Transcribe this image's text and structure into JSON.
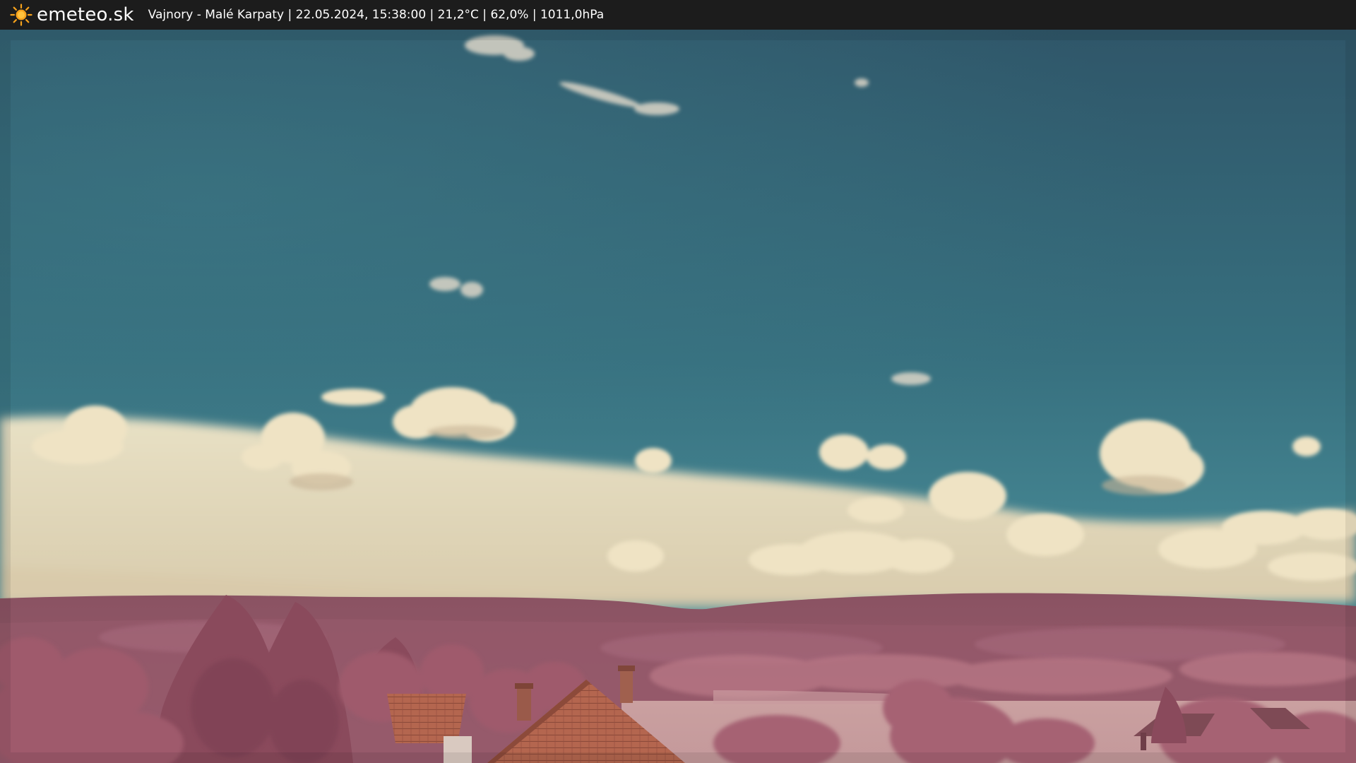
{
  "header": {
    "logo_icon": "sun-icon",
    "site_name": "emeteo.sk",
    "caption": "Vajnory - Malé Karpaty | 22.05.2024, 15:38:00 | 21,2°C | 62,0% | 1011,0hPa"
  },
  "colors": {
    "bar_background": "#1c1c1c",
    "sun": "#f7a21b",
    "sky_top": "#2e5566",
    "sky_bottom": "#3f8898",
    "clouds": "#efe2c4",
    "hills": "#8d5866",
    "foliage": "#a5606f",
    "roof": "#b0654f"
  }
}
